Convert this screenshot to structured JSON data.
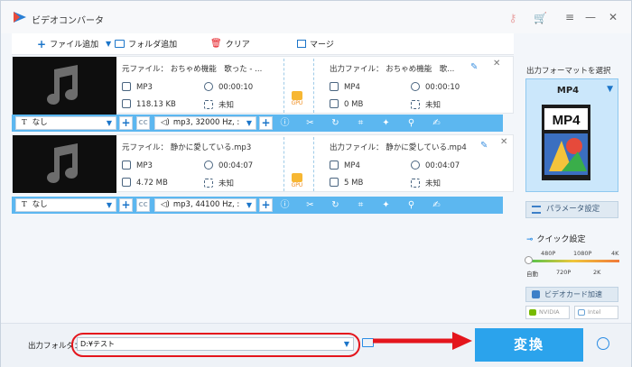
{
  "app": {
    "title": "ビデオコンバータ"
  },
  "toolbar": {
    "add_file": "ファイル追加",
    "add_folder": "フォルダ追加",
    "clear": "クリア",
    "merge": "マージ"
  },
  "files": [
    {
      "source": {
        "name": "元ファイル： おちゃめ機能　歌った - ...",
        "format": "MP3",
        "duration": "00:00:10",
        "size": "118.13 KB",
        "resolution": "未知"
      },
      "output": {
        "name": "出力ファイル： おちゃめ機能　歌...",
        "format": "MP4",
        "duration": "00:00:10",
        "size": "0 MB",
        "resolution": "未知"
      },
      "gpu_label": "GPU",
      "subtitle": "なし",
      "audio": "mp3, 32000 Hz, :"
    },
    {
      "source": {
        "name": "元ファイル： 静かに愛している.mp3",
        "format": "MP3",
        "duration": "00:04:07",
        "size": "4.72 MB",
        "resolution": "未知"
      },
      "output": {
        "name": "出力ファイル： 静かに愛している.mp4",
        "format": "MP4",
        "duration": "00:04:07",
        "size": "5 MB",
        "resolution": "未知"
      },
      "gpu_label": "GPU",
      "subtitle": "なし",
      "audio": "mp3, 44100 Hz, :"
    }
  ],
  "right_panel": {
    "select_format_title": "出力フォーマットを選択",
    "format_name": "MP4",
    "format_art_label": "MP4",
    "param_button": "パラメータ設定",
    "quick_setting": "クイック設定",
    "ticks_top": [
      "480P",
      "1080P",
      "4K"
    ],
    "ticks_bottom": [
      "自動",
      "720P",
      "2K"
    ],
    "gpu_accel": "ビデオカード加速",
    "vendors": [
      "NVIDIA",
      "Intel"
    ]
  },
  "bottom": {
    "output_folder_label": "出力フォルダ：",
    "output_folder_value": "D:¥テスト",
    "convert_button": "変換"
  },
  "colors": {
    "accent": "#2ba3ec",
    "option_bar": "#5cb7f0",
    "highlight": "#e4161d",
    "gpu": "#f7b733"
  }
}
